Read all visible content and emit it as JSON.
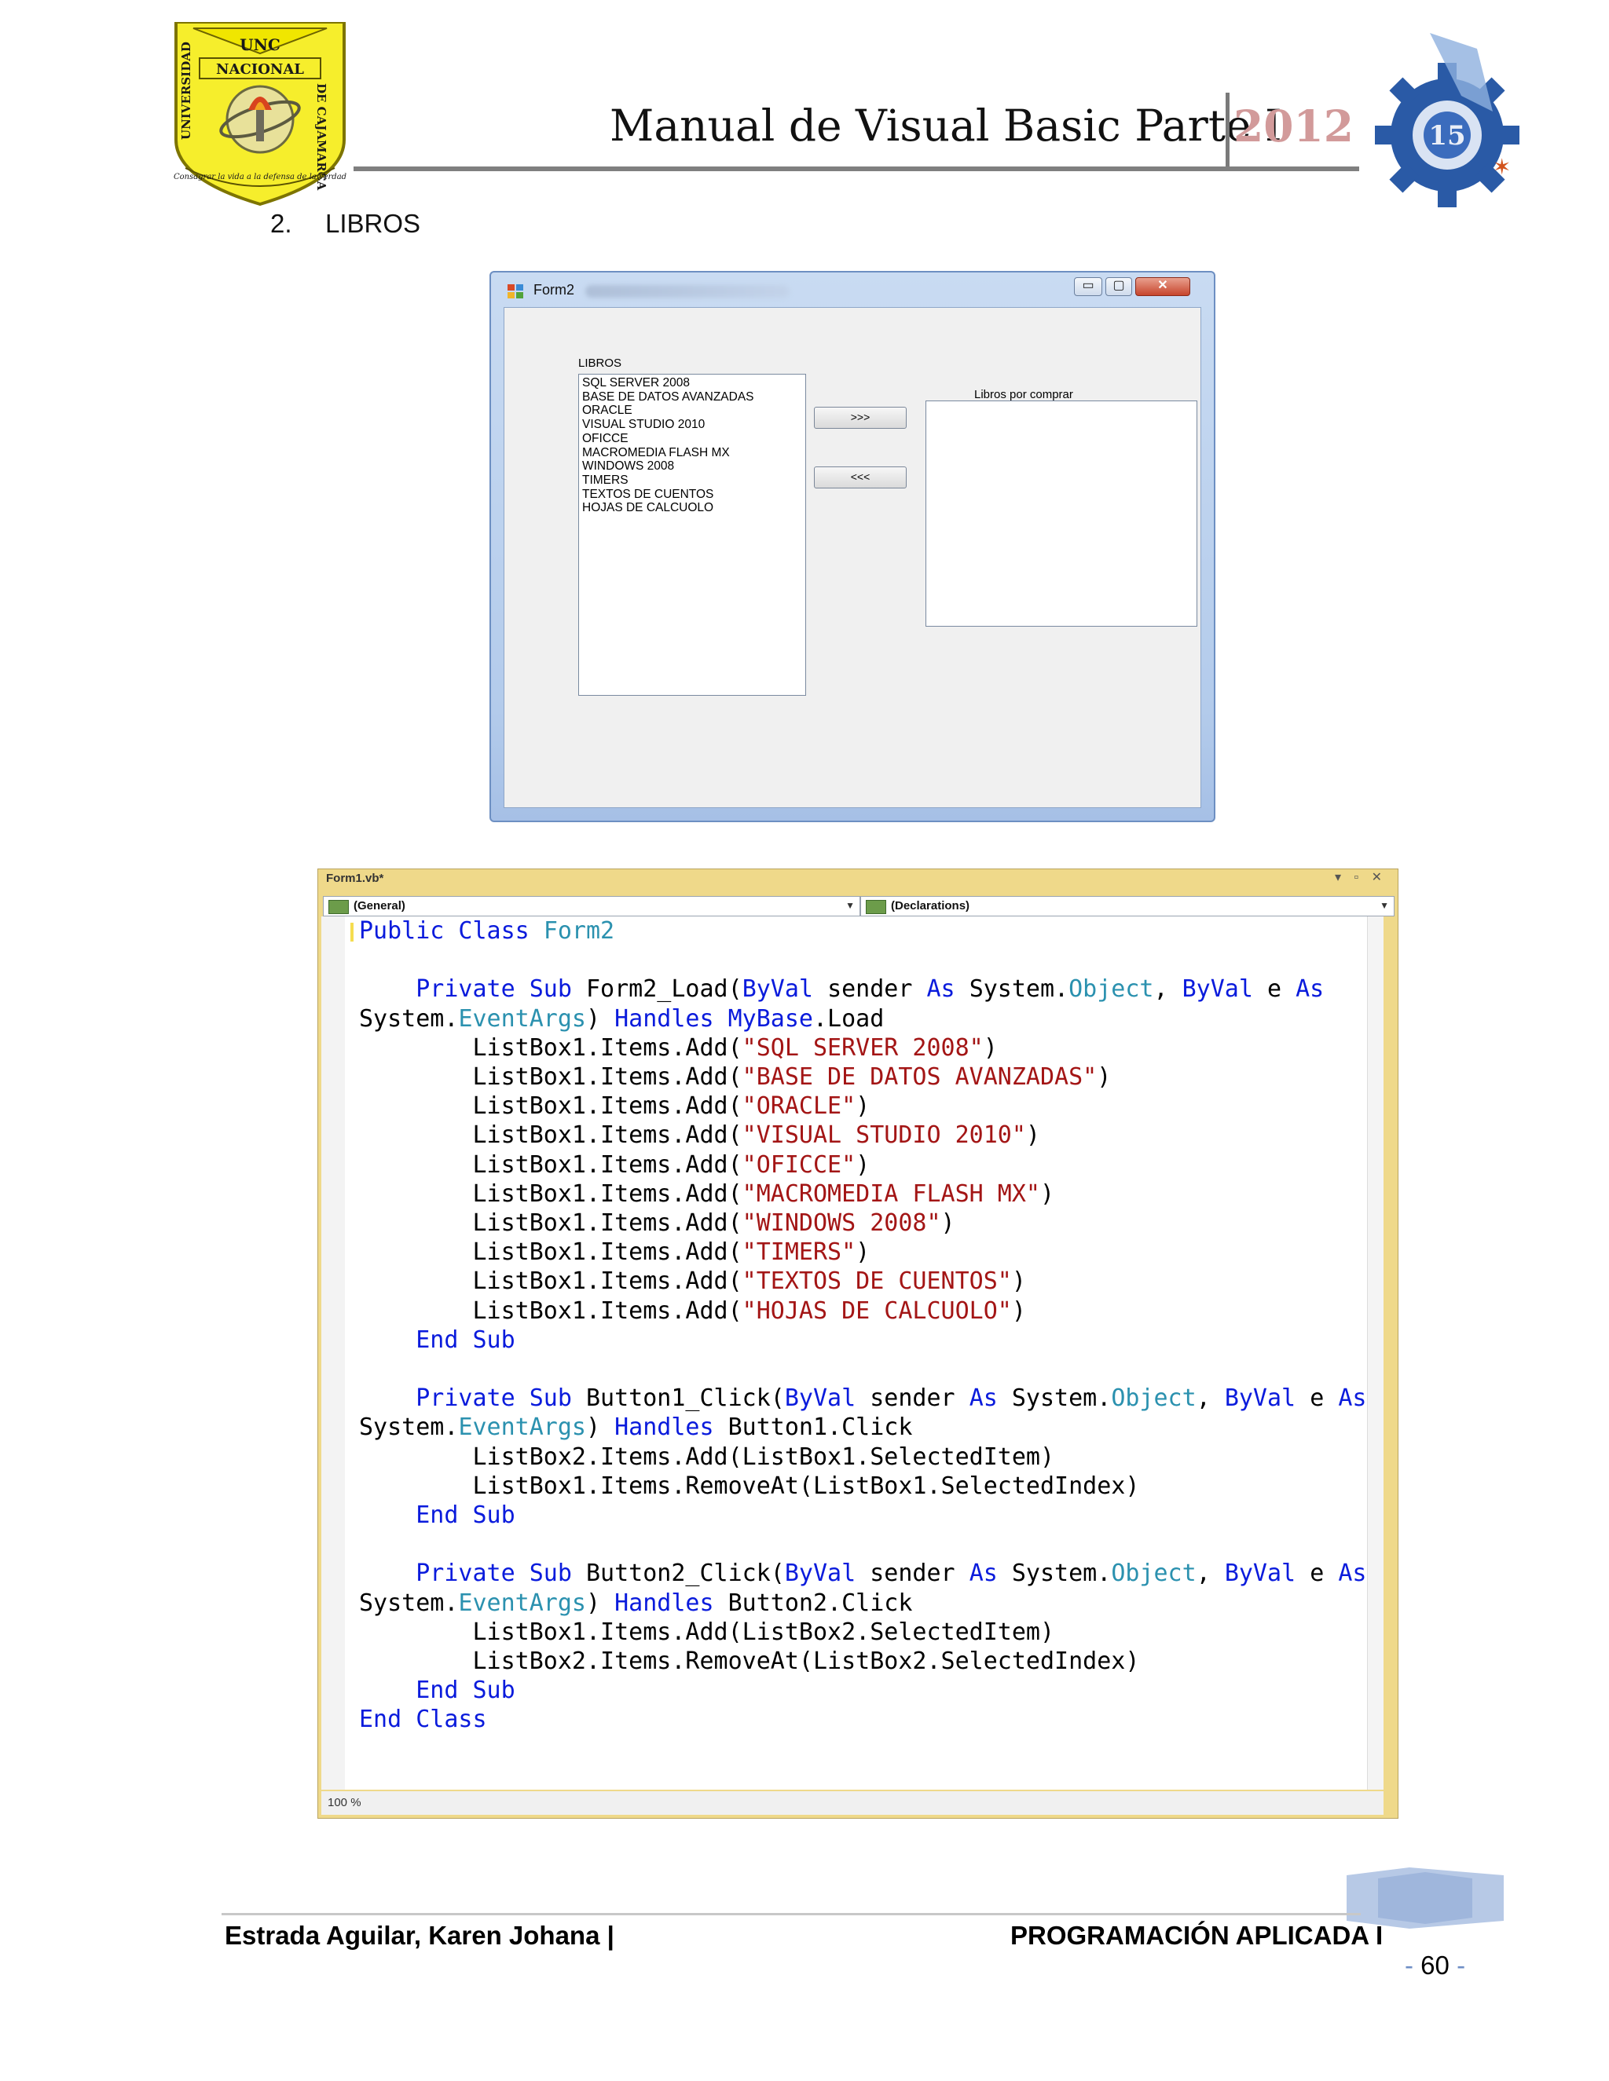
{
  "header": {
    "title": "Manual de Visual Basic Parte I",
    "year": "2012",
    "left_logo": {
      "icon": "university-shield-logo",
      "top_text": "UNC",
      "banner": "NACIONAL",
      "left_side": "UNIVERSIDAD",
      "right_side": "DE CAJAMARCA",
      "motto": "Consagrar la vida a la defensa de la verdad"
    },
    "right_logo": {
      "icon": "gear-faculty-logo"
    }
  },
  "section": {
    "number": "2.",
    "label": "LIBROS"
  },
  "form_window": {
    "title": "Form2",
    "libros_label": "LIBROS",
    "libros_items": [
      "SQL SERVER 2008",
      "BASE DE DATOS AVANZADAS",
      "ORACLE",
      "VISUAL STUDIO 2010",
      "OFICCE",
      "MACROMEDIA FLASH MX",
      "WINDOWS 2008",
      "TIMERS",
      "TEXTOS DE CUENTOS",
      "HOJAS DE CALCUOLO"
    ],
    "comprar_label": "Libros por comprar",
    "button_add": ">>>",
    "button_remove": "<<<",
    "controls": {
      "minimize": "▭",
      "maximize": "▢",
      "close": "✕"
    }
  },
  "code_window": {
    "tab": "Form1.vb*",
    "tab_controls": "▾ ▫ ✕",
    "combo_left": "(General)",
    "combo_right": "(Declarations)",
    "zoom": "100 %",
    "colors": {
      "keyword": "#0a1bdc",
      "type": "#2b91af",
      "string": "#a31515"
    },
    "lines": [
      [
        [
          "kw",
          "Public Class "
        ],
        [
          "ty",
          "Form2"
        ]
      ],
      [],
      [
        [
          "",
          "    "
        ],
        [
          "kw",
          "Private Sub "
        ],
        [
          "",
          "Form2_Load("
        ],
        [
          "kw",
          "ByVal "
        ],
        [
          "",
          "sender "
        ],
        [
          "kw",
          "As "
        ],
        [
          "",
          "System."
        ],
        [
          "ty",
          "Object"
        ],
        [
          "",
          ", "
        ],
        [
          "kw",
          "ByVal "
        ],
        [
          "",
          "e "
        ],
        [
          "kw",
          "As"
        ]
      ],
      [
        [
          "",
          "System."
        ],
        [
          "ty",
          "EventArgs"
        ],
        [
          "",
          ") "
        ],
        [
          "kw",
          "Handles "
        ],
        [
          "kw",
          "MyBase"
        ],
        [
          "",
          ".Load"
        ]
      ],
      [
        [
          "",
          "        ListBox1.Items.Add("
        ],
        [
          "st",
          "\"SQL SERVER 2008\""
        ],
        [
          "",
          ")"
        ]
      ],
      [
        [
          "",
          "        ListBox1.Items.Add("
        ],
        [
          "st",
          "\"BASE DE DATOS AVANZADAS\""
        ],
        [
          "",
          ")"
        ]
      ],
      [
        [
          "",
          "        ListBox1.Items.Add("
        ],
        [
          "st",
          "\"ORACLE\""
        ],
        [
          "",
          ")"
        ]
      ],
      [
        [
          "",
          "        ListBox1.Items.Add("
        ],
        [
          "st",
          "\"VISUAL STUDIO 2010\""
        ],
        [
          "",
          ")"
        ]
      ],
      [
        [
          "",
          "        ListBox1.Items.Add("
        ],
        [
          "st",
          "\"OFICCE\""
        ],
        [
          "",
          ")"
        ]
      ],
      [
        [
          "",
          "        ListBox1.Items.Add("
        ],
        [
          "st",
          "\"MACROMEDIA FLASH MX\""
        ],
        [
          "",
          ")"
        ]
      ],
      [
        [
          "",
          "        ListBox1.Items.Add("
        ],
        [
          "st",
          "\"WINDOWS 2008\""
        ],
        [
          "",
          ")"
        ]
      ],
      [
        [
          "",
          "        ListBox1.Items.Add("
        ],
        [
          "st",
          "\"TIMERS\""
        ],
        [
          "",
          ")"
        ]
      ],
      [
        [
          "",
          "        ListBox1.Items.Add("
        ],
        [
          "st",
          "\"TEXTOS DE CUENTOS\""
        ],
        [
          "",
          ")"
        ]
      ],
      [
        [
          "",
          "        ListBox1.Items.Add("
        ],
        [
          "st",
          "\"HOJAS DE CALCUOLO\""
        ],
        [
          "",
          ")"
        ]
      ],
      [
        [
          "",
          "    "
        ],
        [
          "kw",
          "End Sub"
        ]
      ],
      [],
      [
        [
          "",
          "    "
        ],
        [
          "kw",
          "Private Sub "
        ],
        [
          "",
          "Button1_Click("
        ],
        [
          "kw",
          "ByVal "
        ],
        [
          "",
          "sender "
        ],
        [
          "kw",
          "As "
        ],
        [
          "",
          "System."
        ],
        [
          "ty",
          "Object"
        ],
        [
          "",
          ", "
        ],
        [
          "kw",
          "ByVal "
        ],
        [
          "",
          "e "
        ],
        [
          "kw",
          "As"
        ]
      ],
      [
        [
          "",
          "System."
        ],
        [
          "ty",
          "EventArgs"
        ],
        [
          "",
          ") "
        ],
        [
          "kw",
          "Handles "
        ],
        [
          "",
          "Button1.Click"
        ]
      ],
      [
        [
          "",
          "        ListBox2.Items.Add(ListBox1.SelectedItem)"
        ]
      ],
      [
        [
          "",
          "        ListBox1.Items.RemoveAt(ListBox1.SelectedIndex)"
        ]
      ],
      [
        [
          "",
          "    "
        ],
        [
          "kw",
          "End Sub"
        ]
      ],
      [],
      [
        [
          "",
          "    "
        ],
        [
          "kw",
          "Private Sub "
        ],
        [
          "",
          "Button2_Click("
        ],
        [
          "kw",
          "ByVal "
        ],
        [
          "",
          "sender "
        ],
        [
          "kw",
          "As "
        ],
        [
          "",
          "System."
        ],
        [
          "ty",
          "Object"
        ],
        [
          "",
          ", "
        ],
        [
          "kw",
          "ByVal "
        ],
        [
          "",
          "e "
        ],
        [
          "kw",
          "As"
        ]
      ],
      [
        [
          "",
          "System."
        ],
        [
          "ty",
          "EventArgs"
        ],
        [
          "",
          ") "
        ],
        [
          "kw",
          "Handles "
        ],
        [
          "",
          "Button2.Click"
        ]
      ],
      [
        [
          "",
          "        ListBox1.Items.Add(ListBox2.SelectedItem)"
        ]
      ],
      [
        [
          "",
          "        ListBox2.Items.RemoveAt(ListBox2.SelectedIndex)"
        ]
      ],
      [
        [
          "",
          "    "
        ],
        [
          "kw",
          "End Sub"
        ]
      ],
      [
        [
          "kw",
          "End Class"
        ]
      ]
    ]
  },
  "footer": {
    "author": "Estrada Aguilar, Karen Johana |",
    "course": "PROGRAMACIÓN APLICADA I",
    "page_prefix": "-",
    "page_number": "60",
    "page_suffix": "-"
  }
}
